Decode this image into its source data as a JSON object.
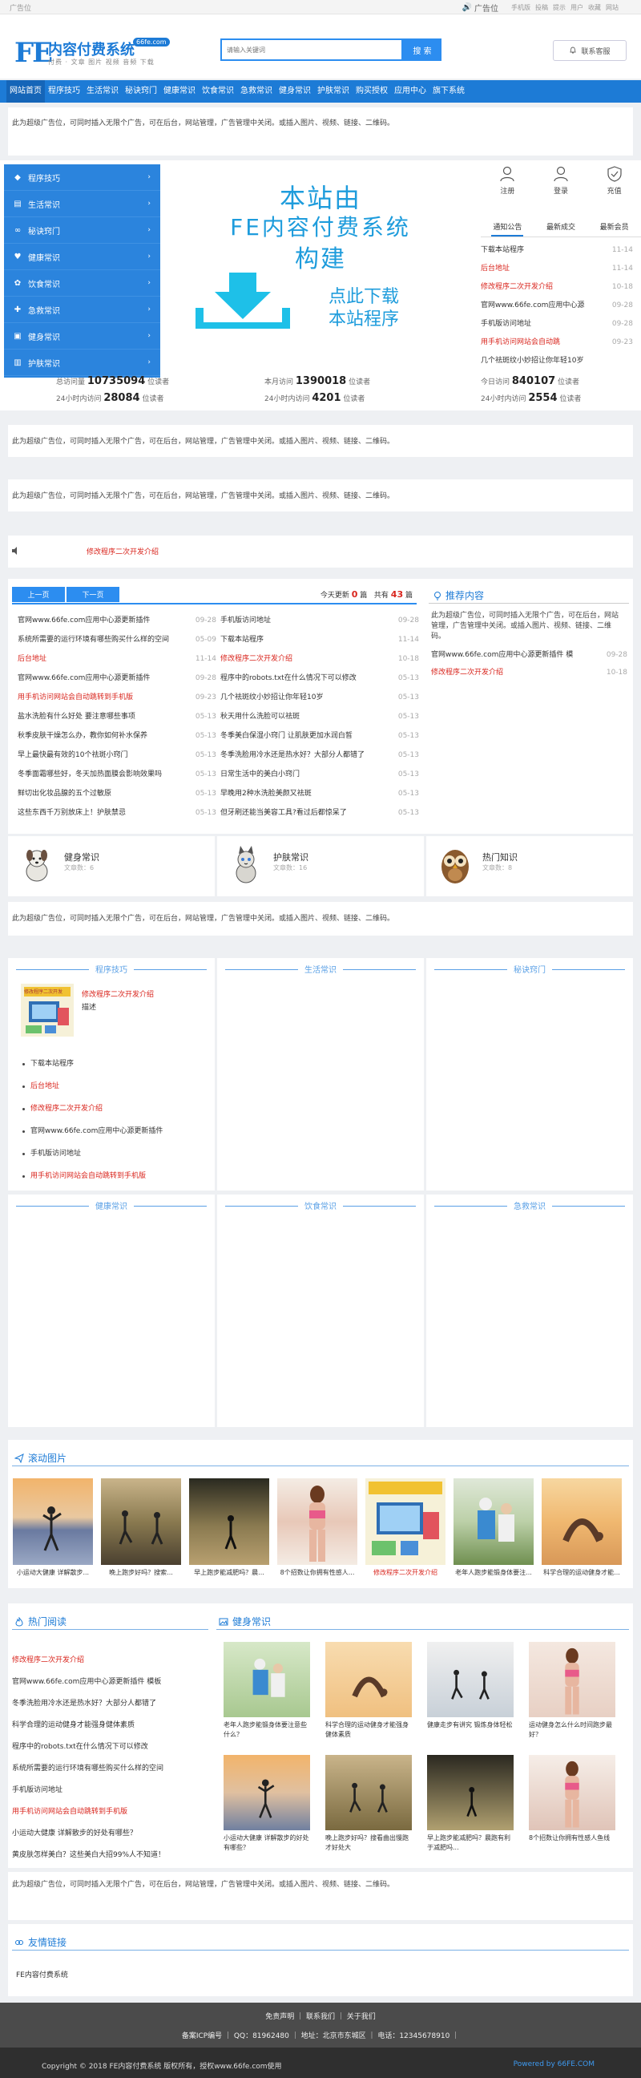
{
  "topbar": {
    "left": "广告位",
    "ad": "广告位",
    "links": [
      "手机版",
      "投稿",
      "提示",
      "用户",
      "收藏",
      "网站"
    ]
  },
  "header": {
    "logo_mark": "FE",
    "logo_title": "内容付费系统",
    "logo_badge": "66fe.com",
    "logo_sub": "付费 · 文章 图片 视频 音频 下载",
    "search_placeholder": "请输入关键词",
    "search_button": "搜 索",
    "contact_button": "联系客服"
  },
  "nav": {
    "items": [
      "网站首页",
      "程序技巧",
      "生活常识",
      "秘诀窍门",
      "健康常识",
      "饮食常识",
      "急救常识",
      "健身常识",
      "护肤常识",
      "购买授权",
      "应用中心",
      "旗下系统"
    ]
  },
  "ad_text": "此为超级广告位，可同时插入无限个广告，可在后台，网站管理，广告管理中关闭。或插入图片、视频、链接、二维码。",
  "sidemenu": {
    "items": [
      {
        "label": "程序技巧",
        "icon": "gem-icon"
      },
      {
        "label": "生活常识",
        "icon": "folder-icon"
      },
      {
        "label": "秘诀窍门",
        "icon": "link-icon"
      },
      {
        "label": "健康常识",
        "icon": "heart-icon"
      },
      {
        "label": "饮食常识",
        "icon": "gear-icon"
      },
      {
        "label": "急救常识",
        "icon": "cross-icon"
      },
      {
        "label": "健身常识",
        "icon": "image-icon"
      },
      {
        "label": "护肤常识",
        "icon": "book-icon"
      }
    ]
  },
  "banner": {
    "line1": "本站由",
    "line2": "FE内容付费系统",
    "line3": "构建",
    "line4": "点此下载",
    "line5": "本站程序"
  },
  "right_box": {
    "actions": [
      "注册",
      "登录",
      "充值"
    ],
    "tabs": [
      "通知公告",
      "最新成交",
      "最新会员"
    ],
    "notices": [
      {
        "title": "下载本站程序",
        "date": "11-14",
        "red": false
      },
      {
        "title": "后台地址",
        "date": "11-14",
        "red": true
      },
      {
        "title": "修改程序二次开发介绍",
        "date": "10-18",
        "red": true
      },
      {
        "title": "官网www.66fe.com应用中心源",
        "date": "09-28",
        "red": false
      },
      {
        "title": "手机版访问地址",
        "date": "09-28",
        "red": false
      },
      {
        "title": "用手机访问网站会自动跳",
        "date": "09-23",
        "red": true
      },
      {
        "title": "几个祛斑纹小妙招让你年轻10岁",
        "date": "",
        "red": false
      }
    ]
  },
  "stats": {
    "items": [
      {
        "label": "总访问量",
        "value": "10735094",
        "unit": "位读者"
      },
      {
        "label": "本月访问",
        "value": "1390018",
        "unit": "位读者"
      },
      {
        "label": "今日访问",
        "value": "840107",
        "unit": "位读者"
      },
      {
        "label": "24小时内访问",
        "value": "28084",
        "unit": "位读者"
      },
      {
        "label": "24小时内访问",
        "value": "4201",
        "unit": "位读者"
      },
      {
        "label": "24小时内访问",
        "value": "2554",
        "unit": "位读者"
      }
    ]
  },
  "scroll_notice": "修改程序二次开发介绍",
  "news": {
    "prev": "上一页",
    "next": "下一页",
    "today_label": "今天更新",
    "today_count": "0",
    "today_unit": "篇",
    "total_label": "共有",
    "total_count": "43",
    "total_unit": "篇",
    "left": [
      {
        "title": "官网www.66fe.com应用中心源更新插件",
        "date": "09-28",
        "red": false
      },
      {
        "title": "系统所需要的运行环境有哪些购买什么样的空间",
        "date": "05-09",
        "red": false
      },
      {
        "title": "后台地址",
        "date": "11-14",
        "red": true
      },
      {
        "title": "官网www.66fe.com应用中心源更新插件",
        "date": "09-28",
        "red": false
      },
      {
        "title": "用手机访问网站会自动跳转到手机版",
        "date": "09-23",
        "red": true
      },
      {
        "title": "盐水洗脸有什么好处 要注意哪些事项",
        "date": "05-13",
        "red": false
      },
      {
        "title": "秋季皮肤干燥怎么办，教你如何补水保养",
        "date": "05-13",
        "red": false
      },
      {
        "title": "早上最快最有效的10个祛斑小窍门",
        "date": "05-13",
        "red": false
      },
      {
        "title": "冬季面霜哪些好，冬天加热面膜会影响效果吗",
        "date": "05-13",
        "red": false
      },
      {
        "title": "鲜切出化妆品腺的五个过敏原",
        "date": "05-13",
        "red": false
      },
      {
        "title": "这些东西千万别放床上！护肤禁忌",
        "date": "05-13",
        "red": false
      }
    ],
    "right": [
      {
        "title": "手机版访问地址",
        "date": "09-28",
        "red": false
      },
      {
        "title": "下载本站程序",
        "date": "11-14",
        "red": false
      },
      {
        "title": "修改程序二次开发介绍",
        "date": "10-18",
        "red": true
      },
      {
        "title": "程序中的robots.txt在什么情况下可以修改",
        "date": "05-13",
        "red": false
      },
      {
        "title": "几个祛斑纹小妙招让你年轻10岁",
        "date": "05-13",
        "red": false
      },
      {
        "title": "秋天用什么洗脸可以祛斑",
        "date": "05-13",
        "red": false
      },
      {
        "title": "冬季美白保湿小窍门 让肌肤更加水润白皙",
        "date": "05-13",
        "red": false
      },
      {
        "title": "冬季洗脸用冷水还是热水好？大部分人都错了",
        "date": "05-13",
        "red": false
      },
      {
        "title": "日常生活中的美白小窍门",
        "date": "05-13",
        "red": false
      },
      {
        "title": "早晚用2种水洗脸美颜又祛斑",
        "date": "05-13",
        "red": false
      },
      {
        "title": "但牙刷还能当美容工具?看过后都惊呆了",
        "date": "05-13",
        "red": false
      }
    ],
    "rec_title": "推荐内容",
    "rec_ad": "此为超级广告位，可同时插入无限个广告，可在后台，网站管理，广告管理中关闭。或插入图片、视频、链接、二维码。",
    "rec_list": [
      {
        "title": "官网www.66fe.com应用中心源更新插件 模",
        "date": "09-28",
        "red": false
      },
      {
        "title": "修改程序二次开发介绍",
        "date": "10-18",
        "red": true
      }
    ]
  },
  "catcards": [
    {
      "title": "健身常识",
      "sub": "文章数：6",
      "icon": "dog-icon"
    },
    {
      "title": "护肤常识",
      "sub": "文章数：16",
      "icon": "cat-icon"
    },
    {
      "title": "热门知识",
      "sub": "文章数：8",
      "icon": "owl-icon"
    }
  ],
  "channels_row1": [
    {
      "title": "程序技巧",
      "feature_title": "修改程序二次开发介绍",
      "feature_desc": "描述",
      "thumb_text": "修改程序二次开发",
      "items": [
        {
          "t": "下载本站程序",
          "red": false
        },
        {
          "t": "后台地址",
          "red": true
        },
        {
          "t": "修改程序二次开发介绍",
          "red": true
        },
        {
          "t": "官网www.66fe.com应用中心源更新插件",
          "red": false
        },
        {
          "t": "手机版访问地址",
          "red": false
        },
        {
          "t": "用手机访问网站会自动跳转到手机版",
          "red": true
        }
      ]
    },
    {
      "title": "生活常识"
    },
    {
      "title": "秘诀窍门"
    }
  ],
  "channels_row2": [
    {
      "title": "健康常识"
    },
    {
      "title": "饮食常识"
    },
    {
      "title": "急救常识"
    }
  ],
  "roll": {
    "title": "滚动图片",
    "items": [
      {
        "cap": "小运动大健康 详解散步...",
        "red": false
      },
      {
        "cap": "晚上跑步好吗？搜索...",
        "red": false
      },
      {
        "cap": "早上跑步能减肥吗？晨...",
        "red": false
      },
      {
        "cap": "8个招数让你拥有性感人...",
        "red": false
      },
      {
        "cap": "修改程序二次开发介绍",
        "red": true
      },
      {
        "cap": "老年人跑步能锻身体要注...",
        "red": false
      },
      {
        "cap": "科学合理的运动健身才能...",
        "red": false
      }
    ]
  },
  "hot": {
    "title": "热门阅读",
    "items": [
      {
        "t": "修改程序二次开发介绍",
        "red": true
      },
      {
        "t": "官网www.66fe.com应用中心源更新插件 模板",
        "red": false
      },
      {
        "t": "冬季洗脸用冷水还是热水好？大部分人都错了",
        "red": false
      },
      {
        "t": "科学合理的运动健身才能强身健体素质",
        "red": false
      },
      {
        "t": "程序中的robots.txt在什么情况下可以修改",
        "red": false
      },
      {
        "t": "系统所需要的运行环境有哪些购买什么样的空间",
        "red": false
      },
      {
        "t": "手机版访问地址",
        "red": false
      },
      {
        "t": "用手机访问网站会自动跳转到手机版",
        "red": true
      },
      {
        "t": "小运动大健康 详解散步的好处有哪些？",
        "red": false
      },
      {
        "t": "黄皮肤怎样美白？这些美白大招99%人不知道！",
        "red": false
      }
    ]
  },
  "health": {
    "title": "健身常识",
    "items": [
      {
        "cap": "老年人跑步能锻身体要注意些什么？",
        "bg": "elderly"
      },
      {
        "cap": "科学合理的运动健身才能强身健体素质",
        "bg": "yoga"
      },
      {
        "cap": "健康走步有讲究 锻炼身体轻松",
        "bg": "crowd"
      },
      {
        "cap": "运动健身怎么什么时间跑步最好？",
        "bg": "fitness"
      },
      {
        "cap": "小运动大健康 详解散步的好处有哪些？",
        "bg": "sunset"
      },
      {
        "cap": "晚上跑步好吗？搜看曲出慢跑才好处大",
        "bg": "forest"
      },
      {
        "cap": "早上跑步能减肥吗？晨跑有利于减肥吗...",
        "bg": "morning"
      },
      {
        "cap": "8个招数让你拥有性感人鱼线",
        "bg": "fitness2"
      }
    ]
  },
  "friend": {
    "title": "友情链接",
    "link": "FE内容付费系统"
  },
  "footer": {
    "links": [
      "免责声明",
      "联系我们",
      "关于我们"
    ],
    "icp": "备案ICP编号 ｜ QQ：81962480 ｜ 地址：北京市东城区 ｜ 电话：12345678910 ｜",
    "copyright": "Copyright © 2018 FE内容付费系统 版权所有，授权www.66fe.com使用",
    "powered": "Powered by 66FE.COM"
  }
}
